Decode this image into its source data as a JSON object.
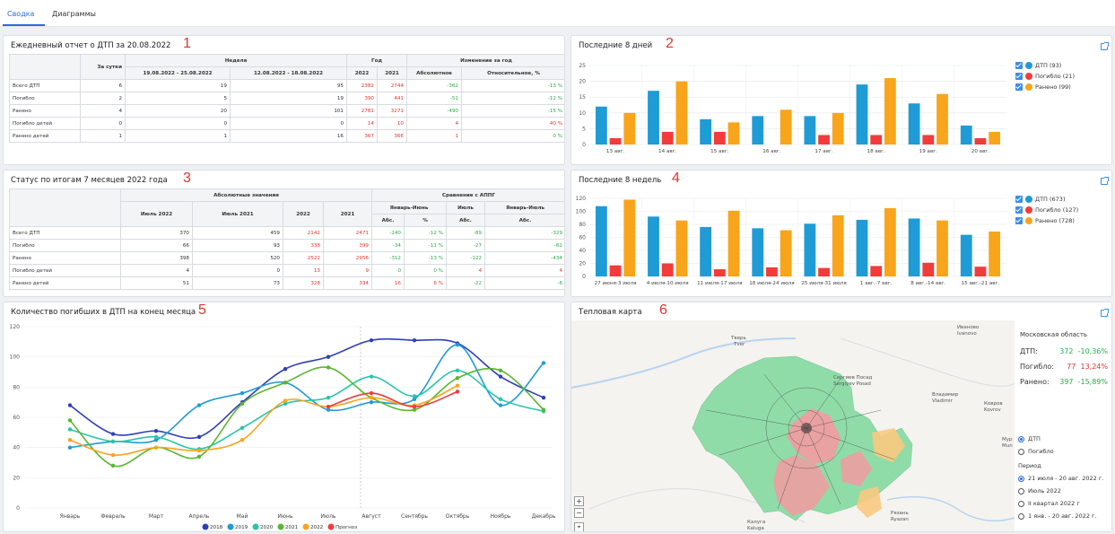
{
  "tabs": {
    "summary": "Сводка",
    "charts": "Диаграммы"
  },
  "p1": {
    "title": "Ежедневный отчет о ДТП за 20.08.2022",
    "num": "1",
    "h": {
      "day": "За сутки",
      "week": "Неделя",
      "year": "Год",
      "change": "Изменение за год",
      "w1": "19.08.2022 - 25.08.2022",
      "w2": "12.08.2022 - 18.08.2022",
      "y1": "2022",
      "y2": "2021",
      "abs": "Абсолютное",
      "rel": "Относительное, %"
    },
    "rows": [
      {
        "name": "Всего ДТП",
        "day": "6",
        "w1": "19",
        "w2": "95",
        "y1": "2382",
        "y2": "2744",
        "abs": "-362",
        "rel": "-13 %"
      },
      {
        "name": "Погибло",
        "day": "2",
        "w1": "5",
        "w2": "19",
        "y1": "390",
        "y2": "441",
        "abs": "-51",
        "rel": "-12 %"
      },
      {
        "name": "Ранено",
        "day": "4",
        "w1": "20",
        "w2": "101",
        "y1": "2781",
        "y2": "3271",
        "abs": "-490",
        "rel": "-15 %"
      },
      {
        "name": "Погибло детей",
        "day": "0",
        "w1": "0",
        "w2": "0",
        "y1": "14",
        "y2": "10",
        "abs": "4",
        "rel": "40 %"
      },
      {
        "name": "Ранено детей",
        "day": "1",
        "w1": "1",
        "w2": "16",
        "y1": "367",
        "y2": "366",
        "abs": "1",
        "rel": "0 %"
      }
    ]
  },
  "p2": {
    "title": "Последние 8 дней",
    "num": "2",
    "legend": [
      "ДТП (93)",
      "Погибло (21)",
      "Ранено (99)"
    ]
  },
  "p3": {
    "title": "Статус по итогам 7 месяцев 2022 года",
    "num": "3",
    "h": {
      "absv": "Абсолютные значения",
      "cmp": "Сравнение с АППГ",
      "jul22": "Июль 2022",
      "jul21": "Июль 2021",
      "y22": "2022",
      "y21": "2021",
      "jj": "Январь-Июнь",
      "jul": "Июль",
      "jjul": "Январь-Июль",
      "a": "Абс.",
      "pct": "%"
    },
    "rows": [
      {
        "name": "Всего ДТП",
        "c1": "370",
        "c2": "459",
        "c3": "2142",
        "c4": "2471",
        "c5": "-240",
        "c6": "-12 %",
        "c7": "-89",
        "c8": "-329"
      },
      {
        "name": "Погибло",
        "c1": "66",
        "c2": "93",
        "c3": "338",
        "c4": "399",
        "c5": "-34",
        "c6": "-11 %",
        "c7": "-27",
        "c8": "-61"
      },
      {
        "name": "Ранено",
        "c1": "398",
        "c2": "520",
        "c3": "2522",
        "c4": "2956",
        "c5": "-312",
        "c6": "-13 %",
        "c7": "-122",
        "c8": "-434"
      },
      {
        "name": "Погибло детей",
        "c1": "4",
        "c2": "0",
        "c3": "13",
        "c4": "9",
        "c5": "0",
        "c6": "0 %",
        "c7": "4",
        "c8": "4"
      },
      {
        "name": "Ранено детей",
        "c1": "51",
        "c2": "73",
        "c3": "328",
        "c4": "334",
        "c5": "16",
        "c6": "6 %",
        "c7": "-22",
        "c8": "-6"
      }
    ]
  },
  "p4": {
    "title": "Последние 8 недель",
    "num": "4",
    "legend": [
      "ДТП (673)",
      "Погибло (127)",
      "Ранено (728)"
    ]
  },
  "p5": {
    "title": "Количество погибших в ДТП на конец месяца",
    "num": "5",
    "legend": [
      "2018",
      "2019",
      "2020",
      "2021",
      "2022",
      "Прогноз"
    ]
  },
  "p6": {
    "title": "Тепловая карта",
    "num": "6",
    "region": "Московская область",
    "stats": [
      {
        "label": "ДТП:",
        "val": "372",
        "pct": "-10,36%"
      },
      {
        "label": "Погибло:",
        "val": "77",
        "pct": "13,24%"
      },
      {
        "label": "Ранено:",
        "val": "397",
        "pct": "-15,89%"
      }
    ],
    "mode": [
      "ДТП",
      "Погибло"
    ],
    "period_label": "Период",
    "periods": [
      "21 июля - 20 авг. 2022 г.",
      "Июль 2022",
      "II квартал 2022 г",
      "1 янв. - 20 авг. 2022 г."
    ],
    "cities": [
      "Тверь",
      "Tver",
      "Иваново",
      "Ivanovo",
      "Сергиев Посад",
      "Sergiyev Posad",
      "Владимир",
      "Vladimir",
      "Ковров",
      "Kovrov",
      "Мур",
      "Мun",
      "Калуга",
      "Kaluga",
      "Рязань",
      "Ryazan"
    ]
  },
  "colors": {
    "blue": "#1f9bd6",
    "red": "#f23b3b",
    "orange": "#f8a51c",
    "accent": "#2b6cd8"
  },
  "chart_data": [
    {
      "type": "bar",
      "title": "Последние 8 дней",
      "categories": [
        "13 авг.",
        "14 авг.",
        "15 авг.",
        "16 авг.",
        "17 авг.",
        "18 авг.",
        "19 авг.",
        "20 авг."
      ],
      "ylim": [
        0,
        25
      ],
      "yticks": [
        0,
        5,
        10,
        15,
        20,
        25
      ],
      "series": [
        {
          "name": "ДТП",
          "values": [
            12,
            17,
            8,
            9,
            9,
            19,
            13,
            6
          ]
        },
        {
          "name": "Погибло",
          "values": [
            2,
            4,
            4,
            0,
            3,
            3,
            3,
            2
          ]
        },
        {
          "name": "Ранено",
          "values": [
            10,
            20,
            7,
            11,
            10,
            21,
            16,
            4
          ]
        }
      ]
    },
    {
      "type": "bar",
      "title": "Последние 8 недель",
      "categories": [
        "27 июня-3 июля",
        "4 июля-10 июля",
        "11 июля-17 июля",
        "18 июля-24 июля",
        "25 июля-31 июля",
        "1 авг.-7 авг.",
        "8 авг.-14 авг.",
        "15 авг.-21 авг."
      ],
      "ylim": [
        0,
        120
      ],
      "yticks": [
        0,
        20,
        40,
        60,
        80,
        100,
        120
      ],
      "series": [
        {
          "name": "ДТП",
          "values": [
            108,
            92,
            76,
            74,
            81,
            87,
            89,
            64
          ]
        },
        {
          "name": "Погибло",
          "values": [
            17,
            20,
            11,
            14,
            13,
            16,
            21,
            15
          ]
        },
        {
          "name": "Ранено",
          "values": [
            118,
            86,
            101,
            71,
            94,
            105,
            86,
            69
          ]
        }
      ]
    },
    {
      "type": "line",
      "title": "Количество погибших в ДТП на конец месяца",
      "categories": [
        "Январь",
        "Февраль",
        "Март",
        "Апрель",
        "Май",
        "Июнь",
        "Июль",
        "Август",
        "Сентябрь",
        "Октябрь",
        "Ноябрь",
        "Декабрь"
      ],
      "ylim": [
        0,
        120
      ],
      "yticks": [
        0,
        20,
        40,
        60,
        80,
        100,
        120
      ],
      "series": [
        {
          "name": "2018",
          "color": "#2f3fb8",
          "values": [
            68,
            49,
            51,
            47,
            70,
            92,
            100,
            111,
            111,
            109,
            87,
            73
          ]
        },
        {
          "name": "2019",
          "color": "#1f9bd6",
          "values": [
            40,
            44,
            45,
            68,
            76,
            83,
            65,
            70,
            72,
            108,
            68,
            96
          ]
        },
        {
          "name": "2020",
          "color": "#26c6a8",
          "values": [
            52,
            44,
            47,
            39,
            53,
            69,
            73,
            87,
            74,
            91,
            72,
            64
          ]
        },
        {
          "name": "2021",
          "color": "#59b72f",
          "values": [
            58,
            28,
            40,
            34,
            69,
            83,
            93,
            73,
            65,
            86,
            91,
            65
          ]
        },
        {
          "name": "2022",
          "color": "#f8a51c",
          "values": [
            45,
            35,
            40,
            38,
            45,
            71,
            67,
            73,
            68,
            81
          ]
        },
        {
          "name": "Прогноз",
          "color": "#f23b3b",
          "values": [
            null,
            null,
            null,
            null,
            null,
            null,
            67,
            76,
            67,
            77
          ]
        }
      ]
    }
  ]
}
